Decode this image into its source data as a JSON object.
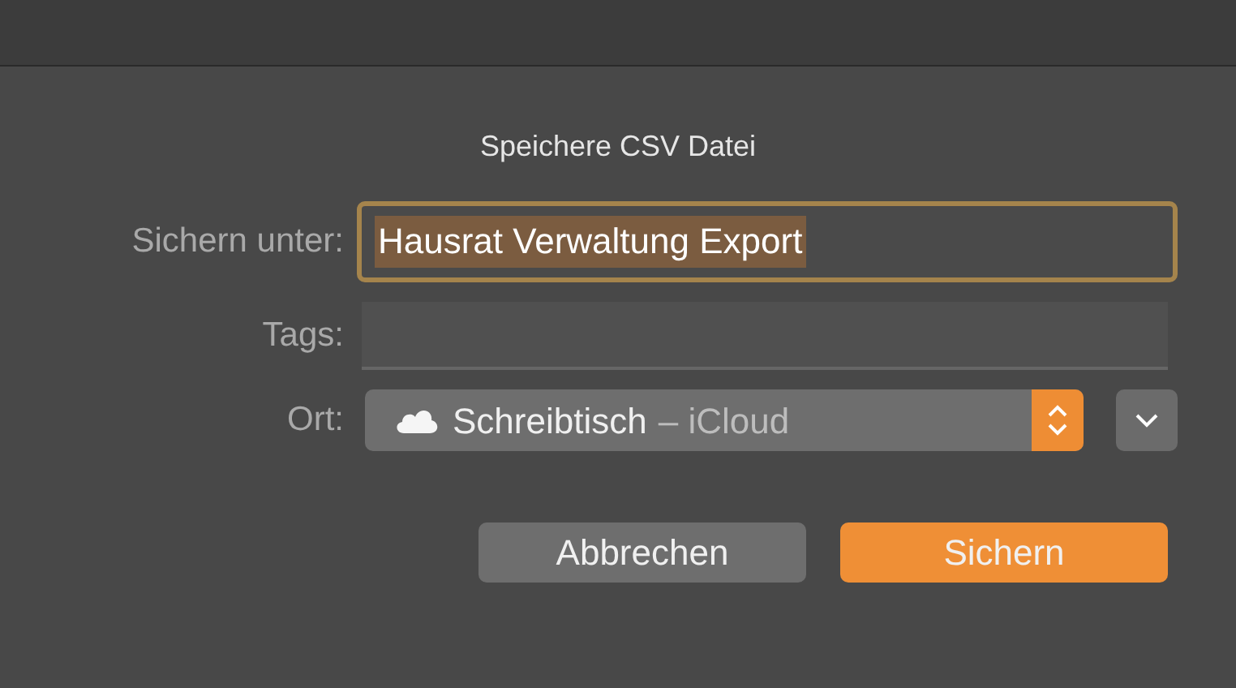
{
  "dialog": {
    "title": "Speichere CSV Datei"
  },
  "save_as": {
    "label": "Sichern unter:",
    "value": "Hausrat Verwaltung Export",
    "focused": true,
    "text_selected": true
  },
  "tags": {
    "label": "Tags:"
  },
  "location": {
    "label": "Ort:",
    "folder": "Schreibtisch",
    "service": "– iCloud"
  },
  "buttons": [
    {
      "label": "Abbrechen",
      "kind": "cancel"
    },
    {
      "label": "Sichern",
      "kind": "default"
    }
  ]
}
